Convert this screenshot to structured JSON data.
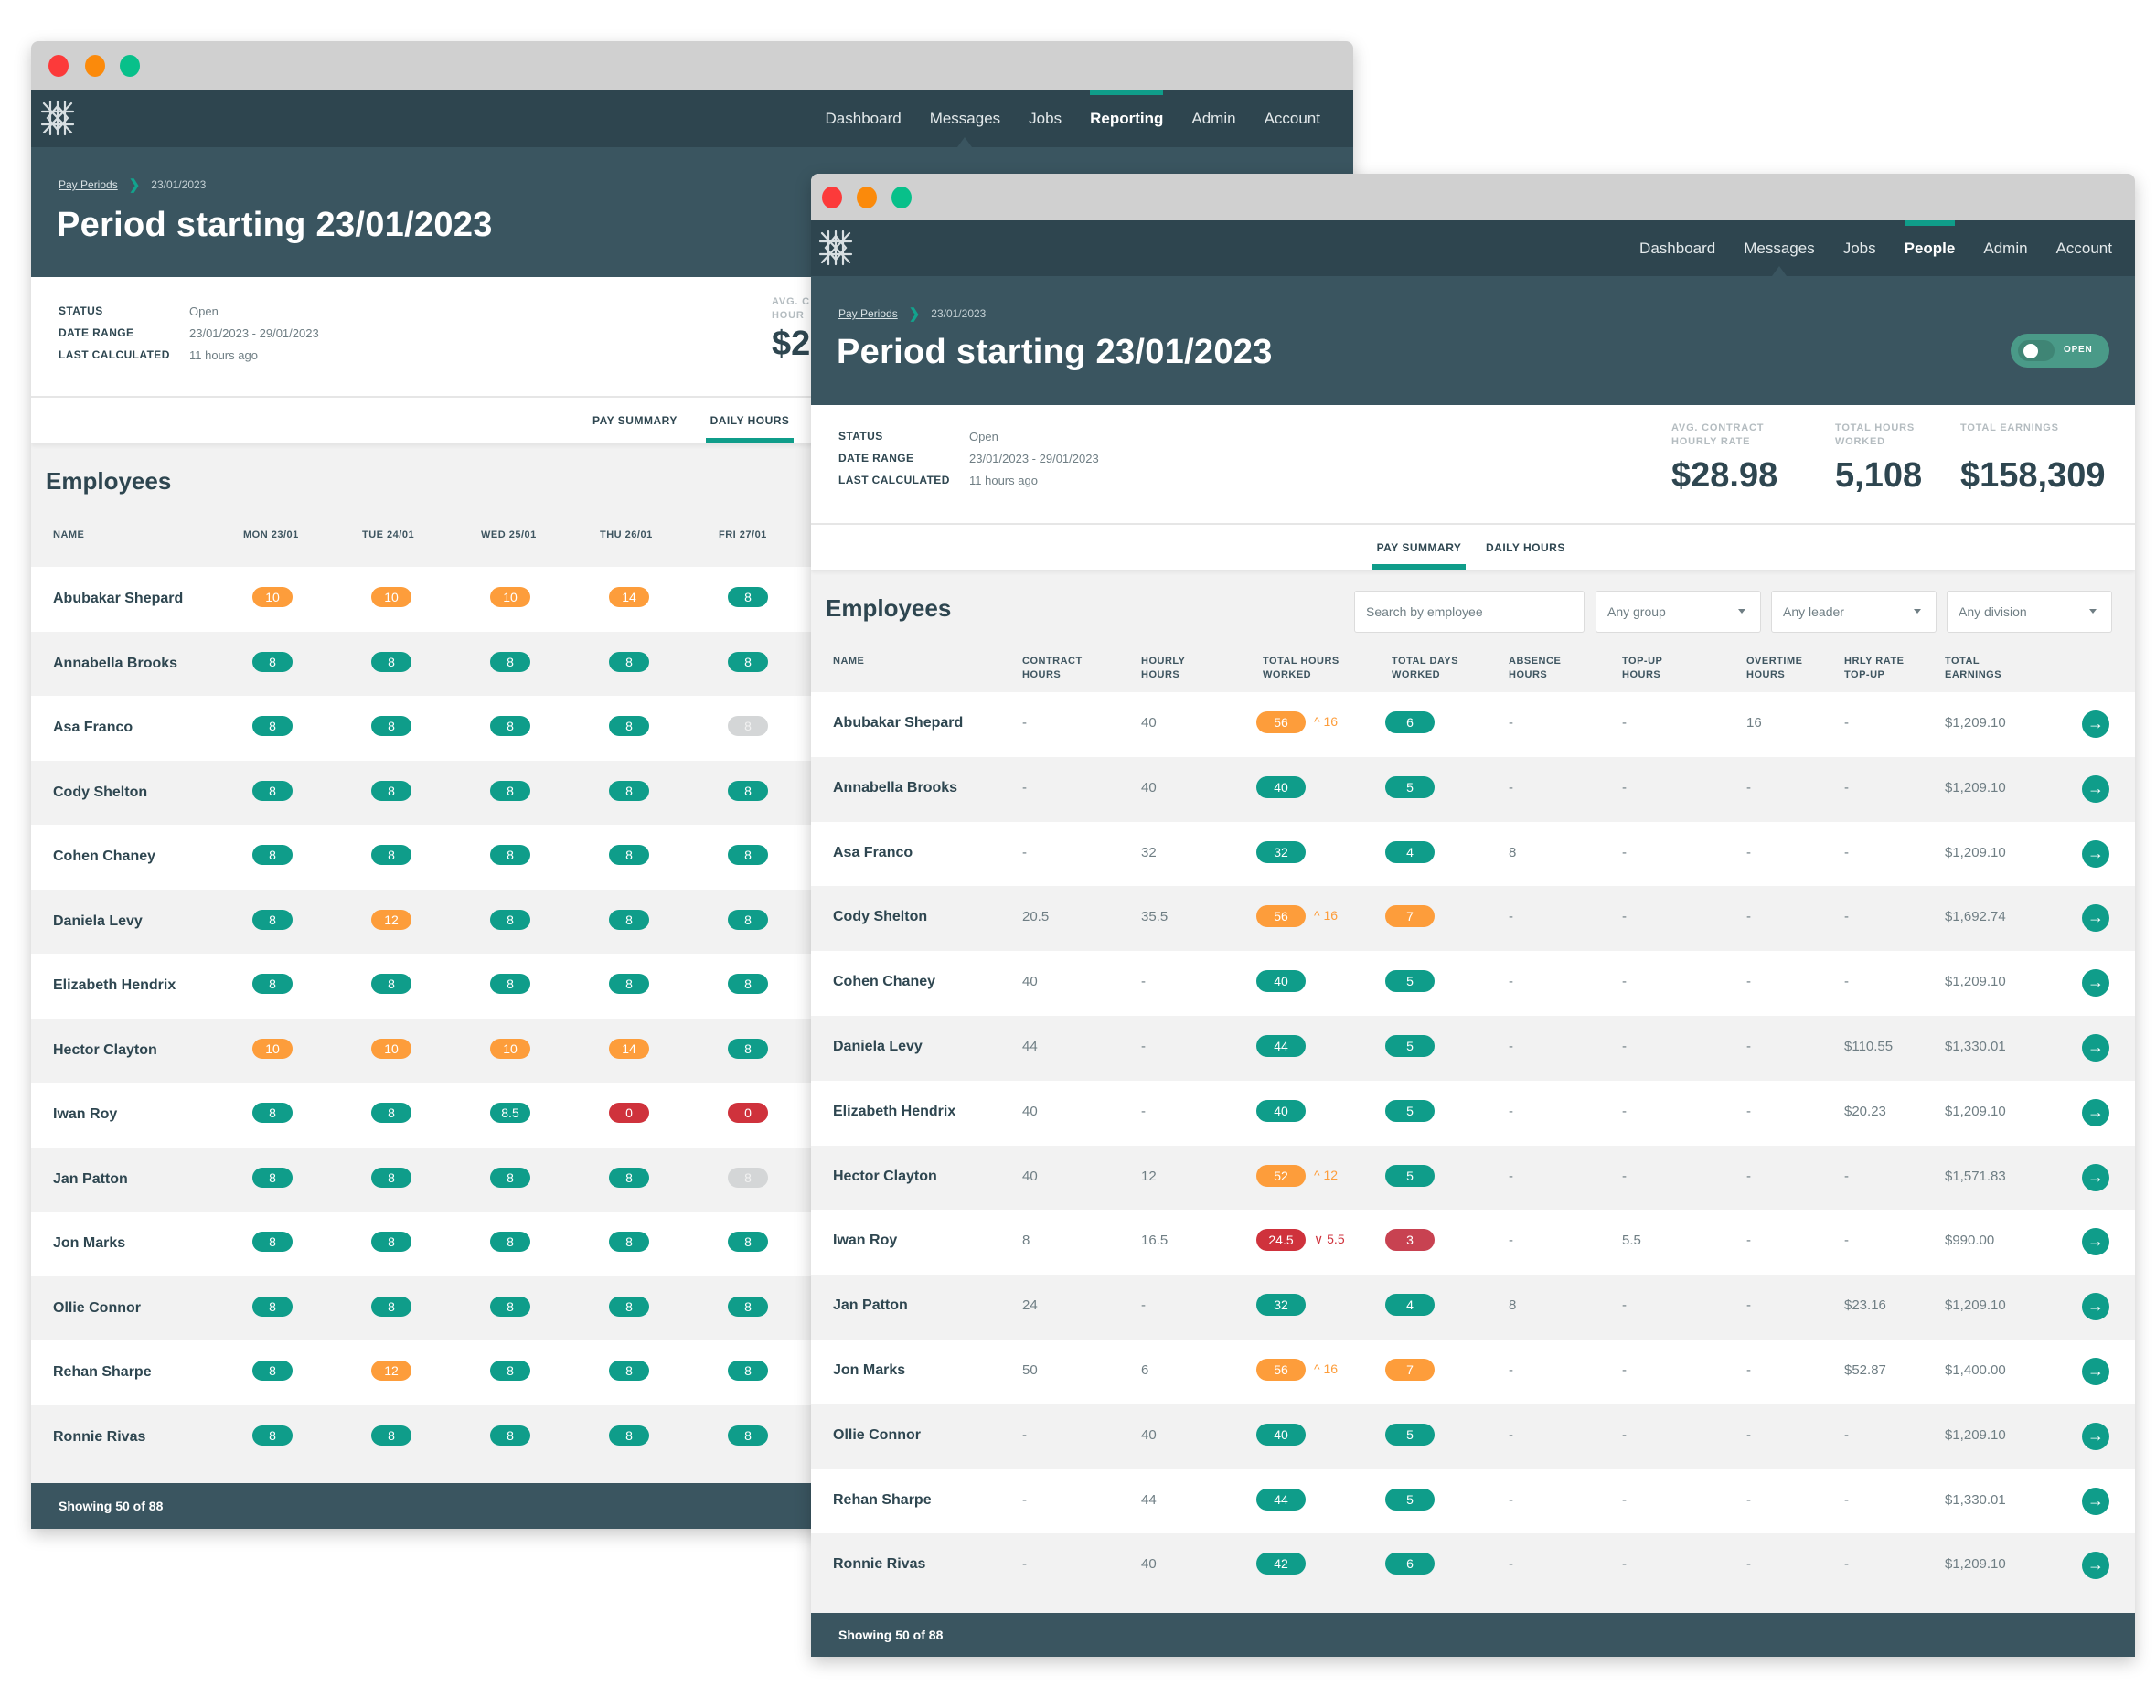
{
  "colors": {
    "accent": "#0f9d8a",
    "nav_bg": "#2e454f",
    "header_bg": "#3a5560",
    "over": "#fd9d3b",
    "under": "#cf323c",
    "inactive": "#d4d6d7"
  },
  "back_window": {
    "nav": {
      "logo": "snowflake-logo",
      "items": [
        "Dashboard",
        "Messages",
        "Jobs",
        "Reporting",
        "Admin",
        "Account"
      ],
      "active": "Reporting"
    },
    "breadcrumb": {
      "parent": "Pay Periods",
      "current": "23/01/2023"
    },
    "title": "Period starting 23/01/2023",
    "info": [
      {
        "key": "STATUS",
        "value": "Open"
      },
      {
        "key": "DATE RANGE",
        "value": "23/01/2023 - 29/01/2023"
      },
      {
        "key": "LAST CALCULATED",
        "value": "11 hours ago"
      }
    ],
    "stat_partial": {
      "label_line1": "AVG. C",
      "label_line2": "HOUR",
      "value": "$2"
    },
    "tabs": [
      {
        "label": "PAY SUMMARY",
        "active": false
      },
      {
        "label": "DAILY HOURS",
        "active": true
      }
    ],
    "section_title": "Employees",
    "columns": [
      "NAME",
      "MON 23/01",
      "TUE 24/01",
      "WED 25/01",
      "THU 26/01",
      "FRI 27/01"
    ],
    "rows": [
      {
        "name": "Abubakar Shepard",
        "days": [
          [
            "10",
            "orange"
          ],
          [
            "10",
            "orange"
          ],
          [
            "10",
            "orange"
          ],
          [
            "14",
            "orange"
          ],
          [
            "8",
            "green"
          ]
        ]
      },
      {
        "name": "Annabella Brooks",
        "days": [
          [
            "8",
            "green"
          ],
          [
            "8",
            "green"
          ],
          [
            "8",
            "green"
          ],
          [
            "8",
            "green"
          ],
          [
            "8",
            "green"
          ]
        ]
      },
      {
        "name": "Asa Franco",
        "days": [
          [
            "8",
            "green"
          ],
          [
            "8",
            "green"
          ],
          [
            "8",
            "green"
          ],
          [
            "8",
            "green"
          ],
          [
            "8",
            "grey"
          ]
        ]
      },
      {
        "name": "Cody Shelton",
        "days": [
          [
            "8",
            "green"
          ],
          [
            "8",
            "green"
          ],
          [
            "8",
            "green"
          ],
          [
            "8",
            "green"
          ],
          [
            "8",
            "green"
          ]
        ]
      },
      {
        "name": "Cohen Chaney",
        "days": [
          [
            "8",
            "green"
          ],
          [
            "8",
            "green"
          ],
          [
            "8",
            "green"
          ],
          [
            "8",
            "green"
          ],
          [
            "8",
            "green"
          ]
        ]
      },
      {
        "name": "Daniela Levy",
        "days": [
          [
            "8",
            "green"
          ],
          [
            "12",
            "orange"
          ],
          [
            "8",
            "green"
          ],
          [
            "8",
            "green"
          ],
          [
            "8",
            "green"
          ]
        ]
      },
      {
        "name": "Elizabeth Hendrix",
        "days": [
          [
            "8",
            "green"
          ],
          [
            "8",
            "green"
          ],
          [
            "8",
            "green"
          ],
          [
            "8",
            "green"
          ],
          [
            "8",
            "green"
          ]
        ]
      },
      {
        "name": "Hector Clayton",
        "days": [
          [
            "10",
            "orange"
          ],
          [
            "10",
            "orange"
          ],
          [
            "10",
            "orange"
          ],
          [
            "14",
            "orange"
          ],
          [
            "8",
            "green"
          ]
        ]
      },
      {
        "name": "Iwan Roy",
        "days": [
          [
            "8",
            "green"
          ],
          [
            "8",
            "green"
          ],
          [
            "8.5",
            "green"
          ],
          [
            "0",
            "red"
          ],
          [
            "0",
            "red"
          ]
        ]
      },
      {
        "name": "Jan Patton",
        "days": [
          [
            "8",
            "green"
          ],
          [
            "8",
            "green"
          ],
          [
            "8",
            "green"
          ],
          [
            "8",
            "green"
          ],
          [
            "8",
            "grey"
          ]
        ]
      },
      {
        "name": "Jon Marks",
        "days": [
          [
            "8",
            "green"
          ],
          [
            "8",
            "green"
          ],
          [
            "8",
            "green"
          ],
          [
            "8",
            "green"
          ],
          [
            "8",
            "green"
          ]
        ]
      },
      {
        "name": "Ollie Connor",
        "days": [
          [
            "8",
            "green"
          ],
          [
            "8",
            "green"
          ],
          [
            "8",
            "green"
          ],
          [
            "8",
            "green"
          ],
          [
            "8",
            "green"
          ]
        ]
      },
      {
        "name": "Rehan Sharpe",
        "days": [
          [
            "8",
            "green"
          ],
          [
            "12",
            "orange"
          ],
          [
            "8",
            "green"
          ],
          [
            "8",
            "green"
          ],
          [
            "8",
            "green"
          ]
        ]
      },
      {
        "name": "Ronnie Rivas",
        "days": [
          [
            "8",
            "green"
          ],
          [
            "8",
            "green"
          ],
          [
            "8",
            "green"
          ],
          [
            "8",
            "green"
          ],
          [
            "8",
            "green"
          ]
        ]
      }
    ],
    "footer": "Showing 50 of 88"
  },
  "front_window": {
    "nav": {
      "logo": "snowflake-logo",
      "items": [
        "Dashboard",
        "Messages",
        "Jobs",
        "People",
        "Admin",
        "Account"
      ],
      "active": "People"
    },
    "breadcrumb": {
      "parent": "Pay Periods",
      "current": "23/01/2023"
    },
    "title": "Period starting 23/01/2023",
    "toggle": {
      "label": "OPEN",
      "on": true
    },
    "info": [
      {
        "key": "STATUS",
        "value": "Open"
      },
      {
        "key": "DATE RANGE",
        "value": "23/01/2023 - 29/01/2023"
      },
      {
        "key": "LAST CALCULATED",
        "value": "11 hours ago"
      }
    ],
    "stats": [
      {
        "label_line1": "AVG. CONTRACT",
        "label_line2": "HOURLY RATE",
        "value": "$28.98"
      },
      {
        "label_line1": "TOTAL HOURS",
        "label_line2": "WORKED",
        "value": "5,108"
      },
      {
        "label_line1": "TOTAL EARNINGS",
        "label_line2": "",
        "value": "$158,309"
      }
    ],
    "tabs": [
      {
        "label": "PAY SUMMARY",
        "active": true
      },
      {
        "label": "DAILY HOURS",
        "active": false
      }
    ],
    "section_title": "Employees",
    "filters": {
      "search_placeholder": "Search by employee",
      "group": "Any group",
      "leader": "Any leader",
      "division": "Any division"
    },
    "columns": [
      [
        "NAME",
        ""
      ],
      [
        "CONTRACT",
        "HOURS"
      ],
      [
        "HOURLY",
        "HOURS"
      ],
      [
        "TOTAL HOURS",
        "WORKED"
      ],
      [
        "TOTAL DAYS",
        "WORKED"
      ],
      [
        "ABSENCE",
        "HOURS"
      ],
      [
        "TOP-UP",
        "HOURS"
      ],
      [
        "OVERTIME",
        "HOURS"
      ],
      [
        "HRLY RATE",
        "TOP-UP"
      ],
      [
        "TOTAL",
        "EARNINGS"
      ]
    ],
    "rows": [
      {
        "name": "Abubakar Shepard",
        "contract": "-",
        "hourly": "40",
        "total_hours": "56",
        "total_hours_status": "orange",
        "delta": "16",
        "delta_dir": "up",
        "days": "6",
        "days_status": "green",
        "absence": "-",
        "topup": "-",
        "overtime": "16",
        "rate_topup": "-",
        "earnings": "$1,209.10"
      },
      {
        "name": "Annabella Brooks",
        "contract": "-",
        "hourly": "40",
        "total_hours": "40",
        "total_hours_status": "green",
        "delta": "",
        "delta_dir": "",
        "days": "5",
        "days_status": "green",
        "absence": "-",
        "topup": "-",
        "overtime": "-",
        "rate_topup": "-",
        "earnings": "$1,209.10"
      },
      {
        "name": "Asa Franco",
        "contract": "-",
        "hourly": "32",
        "total_hours": "32",
        "total_hours_status": "green",
        "delta": "",
        "delta_dir": "",
        "days": "4",
        "days_status": "green",
        "absence": "8",
        "topup": "-",
        "overtime": "-",
        "rate_topup": "-",
        "earnings": "$1,209.10"
      },
      {
        "name": "Cody Shelton",
        "contract": "20.5",
        "hourly": "35.5",
        "total_hours": "56",
        "total_hours_status": "orange",
        "delta": "16",
        "delta_dir": "up",
        "days": "7",
        "days_status": "orange",
        "absence": "-",
        "topup": "-",
        "overtime": "-",
        "rate_topup": "-",
        "earnings": "$1,692.74"
      },
      {
        "name": "Cohen Chaney",
        "contract": "40",
        "hourly": "-",
        "total_hours": "40",
        "total_hours_status": "green",
        "delta": "",
        "delta_dir": "",
        "days": "5",
        "days_status": "green",
        "absence": "-",
        "topup": "-",
        "overtime": "-",
        "rate_topup": "-",
        "earnings": "$1,209.10"
      },
      {
        "name": "Daniela Levy",
        "contract": "44",
        "hourly": "-",
        "total_hours": "44",
        "total_hours_status": "green",
        "delta": "",
        "delta_dir": "",
        "days": "5",
        "days_status": "green",
        "absence": "-",
        "topup": "-",
        "overtime": "-",
        "rate_topup": "$110.55",
        "earnings": "$1,330.01"
      },
      {
        "name": "Elizabeth Hendrix",
        "contract": "40",
        "hourly": "-",
        "total_hours": "40",
        "total_hours_status": "green",
        "delta": "",
        "delta_dir": "",
        "days": "5",
        "days_status": "green",
        "absence": "-",
        "topup": "-",
        "overtime": "-",
        "rate_topup": "$20.23",
        "earnings": "$1,209.10"
      },
      {
        "name": "Hector Clayton",
        "contract": "40",
        "hourly": "12",
        "total_hours": "52",
        "total_hours_status": "orange",
        "delta": "12",
        "delta_dir": "up",
        "days": "5",
        "days_status": "green",
        "absence": "-",
        "topup": "-",
        "overtime": "-",
        "rate_topup": "-",
        "earnings": "$1,571.83"
      },
      {
        "name": "Iwan Roy",
        "contract": "8",
        "hourly": "16.5",
        "total_hours": "24.5",
        "total_hours_status": "red",
        "delta": "5.5",
        "delta_dir": "down",
        "days": "3",
        "days_status": "red",
        "absence": "-",
        "topup": "5.5",
        "overtime": "-",
        "rate_topup": "-",
        "earnings": "$990.00"
      },
      {
        "name": "Jan Patton",
        "contract": "24",
        "hourly": "-",
        "total_hours": "32",
        "total_hours_status": "green",
        "delta": "",
        "delta_dir": "",
        "days": "4",
        "days_status": "green",
        "absence": "8",
        "topup": "-",
        "overtime": "-",
        "rate_topup": "$23.16",
        "earnings": "$1,209.10"
      },
      {
        "name": "Jon Marks",
        "contract": "50",
        "hourly": "6",
        "total_hours": "56",
        "total_hours_status": "orange",
        "delta": "16",
        "delta_dir": "up",
        "days": "7",
        "days_status": "orange",
        "absence": "-",
        "topup": "-",
        "overtime": "-",
        "rate_topup": "$52.87",
        "earnings": "$1,400.00"
      },
      {
        "name": "Ollie Connor",
        "contract": "-",
        "hourly": "40",
        "total_hours": "40",
        "total_hours_status": "green",
        "delta": "",
        "delta_dir": "",
        "days": "5",
        "days_status": "green",
        "absence": "-",
        "topup": "-",
        "overtime": "-",
        "rate_topup": "-",
        "earnings": "$1,209.10"
      },
      {
        "name": "Rehan Sharpe",
        "contract": "-",
        "hourly": "44",
        "total_hours": "44",
        "total_hours_status": "green",
        "delta": "",
        "delta_dir": "",
        "days": "5",
        "days_status": "green",
        "absence": "-",
        "topup": "-",
        "overtime": "-",
        "rate_topup": "-",
        "earnings": "$1,330.01"
      },
      {
        "name": "Ronnie Rivas",
        "contract": "-",
        "hourly": "40",
        "total_hours": "42",
        "total_hours_status": "green",
        "delta": "",
        "delta_dir": "",
        "days": "6",
        "days_status": "green",
        "absence": "-",
        "topup": "-",
        "overtime": "-",
        "rate_topup": "-",
        "earnings": "$1,209.10"
      }
    ],
    "row_action_icon": "arrow-right-icon",
    "footer": "Showing 50 of 88"
  }
}
